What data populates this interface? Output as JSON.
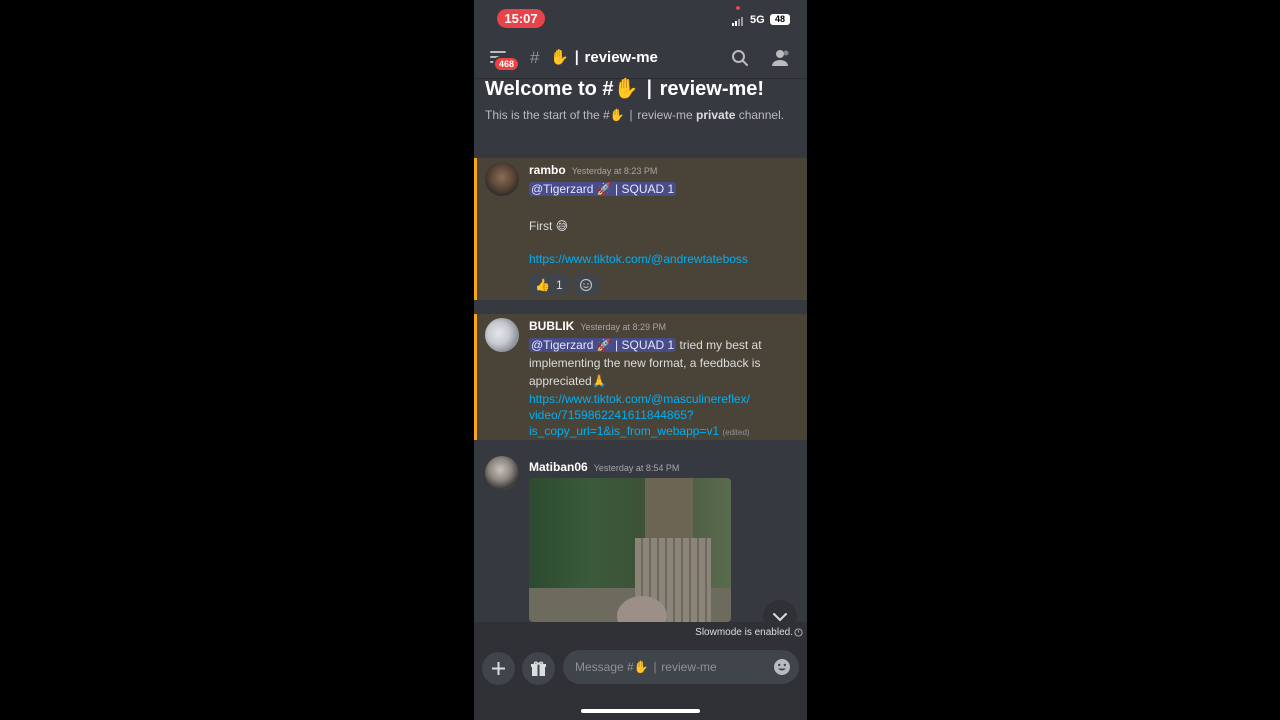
{
  "status_bar": {
    "time": "15:07",
    "network": "5G",
    "battery": "48"
  },
  "header": {
    "badge": "468",
    "hash": "#",
    "channel_name": "✋ ∣ review-me"
  },
  "welcome": {
    "title": "Welcome to #✋ ∣ review-me!",
    "sub_prefix": "This is the start of the #✋ ∣ review-me ",
    "sub_bold": "private",
    "sub_suffix": " channel."
  },
  "messages": [
    {
      "author": "rambo",
      "timestamp": "Yesterday at 8:23 PM",
      "mention": "@Tigerzard 🚀 | SQUAD 1",
      "text1": "First 😅",
      "link": "https://www.tiktok.com/@andrewtateboss",
      "reaction_emoji": "👍",
      "reaction_count": "1"
    },
    {
      "author": "BUBLIK",
      "timestamp": "Yesterday at 8:29 PM",
      "mention": "@Tigerzard 🚀 | SQUAD 1",
      "text_after_mention": " tried my best at",
      "text2": "implementing the new format, a feedback is",
      "text3": "appreciated🙏",
      "link1": "https://www.tiktok.com/@masculinereflex/",
      "link2": "video/7159862241611844865?",
      "link3": "is_copy_url=1&is_from_webapp=v1",
      "edited": "(edited)"
    },
    {
      "author": "Matiban06",
      "timestamp": "Yesterday at 8:54 PM"
    }
  ],
  "slowmode": "Slowmode is enabled.",
  "composer": {
    "placeholder": "Message #✋ ∣ review-me"
  },
  "colors": {
    "background": "#36393f",
    "mention_bg": "#4a4438",
    "mention_bar": "#faa61a",
    "link": "#00aff4",
    "badge": "#ed4245"
  }
}
